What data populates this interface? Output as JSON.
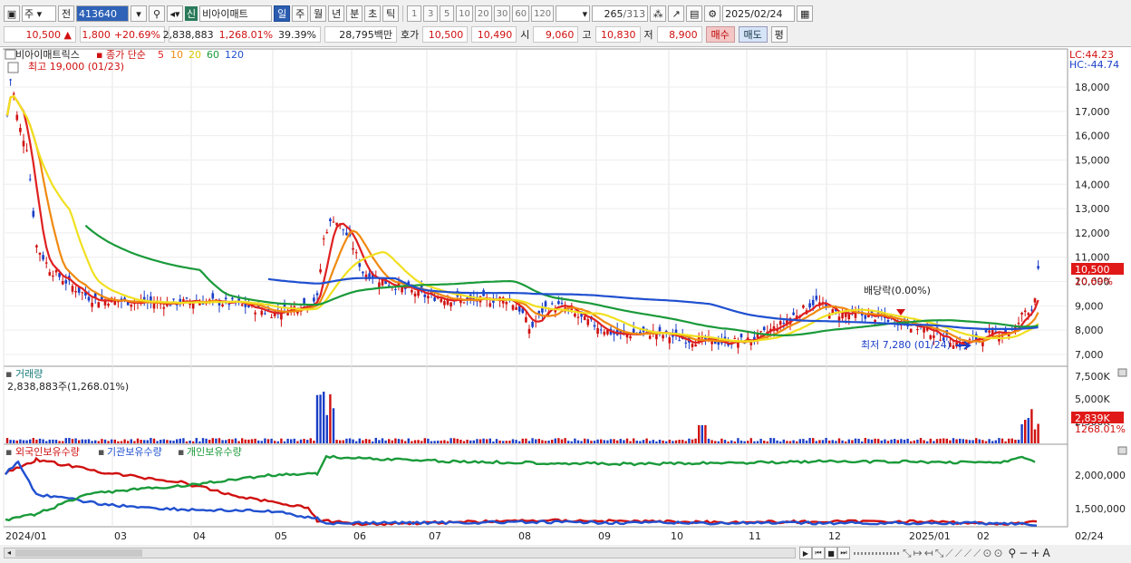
{
  "toolbar": {
    "unit": "주",
    "unit2": "전",
    "code": "413640",
    "new_badge": "신",
    "name": "비아이매트",
    "periods": [
      "일",
      "주",
      "월",
      "년",
      "분",
      "초",
      "틱"
    ],
    "period_selected": "일",
    "intervals": [
      "1",
      "3",
      "5",
      "10",
      "20",
      "30",
      "60",
      "120"
    ],
    "count": "265",
    "total": "/313",
    "date": "2025/02/24"
  },
  "quote": {
    "price": "10,500",
    "arrow": "▲",
    "change": "1,800",
    "rate": "+20.69%",
    "volume": "2,838,883",
    "volume_rate": "1,268.01%",
    "turnover": "39.39%",
    "amount": "28,795백만",
    "ask_label": "호가",
    "ask1": "10,500",
    "ask2": "10,490",
    "open_label": "시",
    "open": "9,060",
    "high_label": "고",
    "high": "10,830",
    "low_label": "저",
    "low": "8,900",
    "buy": "매수",
    "sell": "매도",
    "eval": "평"
  },
  "price_panel": {
    "stock_label": "비아이매트릭스",
    "ma_label": "종가 단순",
    "ma_periods": [
      "5",
      "10",
      "20",
      "60",
      "120"
    ],
    "ma_colors": [
      "#e02020",
      "#f08a10",
      "#f0e020",
      "#1a9a3a",
      "#2050d0"
    ],
    "high_note": "최고 19,000 (01/23)",
    "low_note": "최저 7,280 (01/24)",
    "dividend_note": "배당락(0.00%)",
    "lc": "LC:44.23",
    "hc": "HC:-44.74",
    "price_tag": "10,500",
    "rate_tag": "20.69%",
    "y_ticks": [
      "18,000",
      "17,000",
      "16,000",
      "15,000",
      "14,000",
      "13,000",
      "12,000",
      "11,000",
      "10,000",
      "9,000",
      "8,000",
      "7,000"
    ]
  },
  "volume_panel": {
    "title": "거래량",
    "value": "2,838,883주(1,268.01%)",
    "y_ticks": [
      "7,500K",
      "5,000K",
      "2,500K"
    ],
    "tag": "2,839K",
    "tag2": "1268.01%"
  },
  "holding_panel": {
    "titles": [
      "외국인보유수량",
      "기관보유수량",
      "개인보유수량"
    ],
    "colors": [
      "#d01010",
      "#2050d0",
      "#1a9a3a"
    ],
    "y_ticks": [
      "2,000,000",
      "1,500,000"
    ]
  },
  "x_axis": {
    "labels": [
      "2024/01",
      "03",
      "04",
      "05",
      "06",
      "07",
      "08",
      "09",
      "10",
      "11",
      "12",
      "2025/01",
      "02"
    ],
    "right_label": "02/24"
  }
}
